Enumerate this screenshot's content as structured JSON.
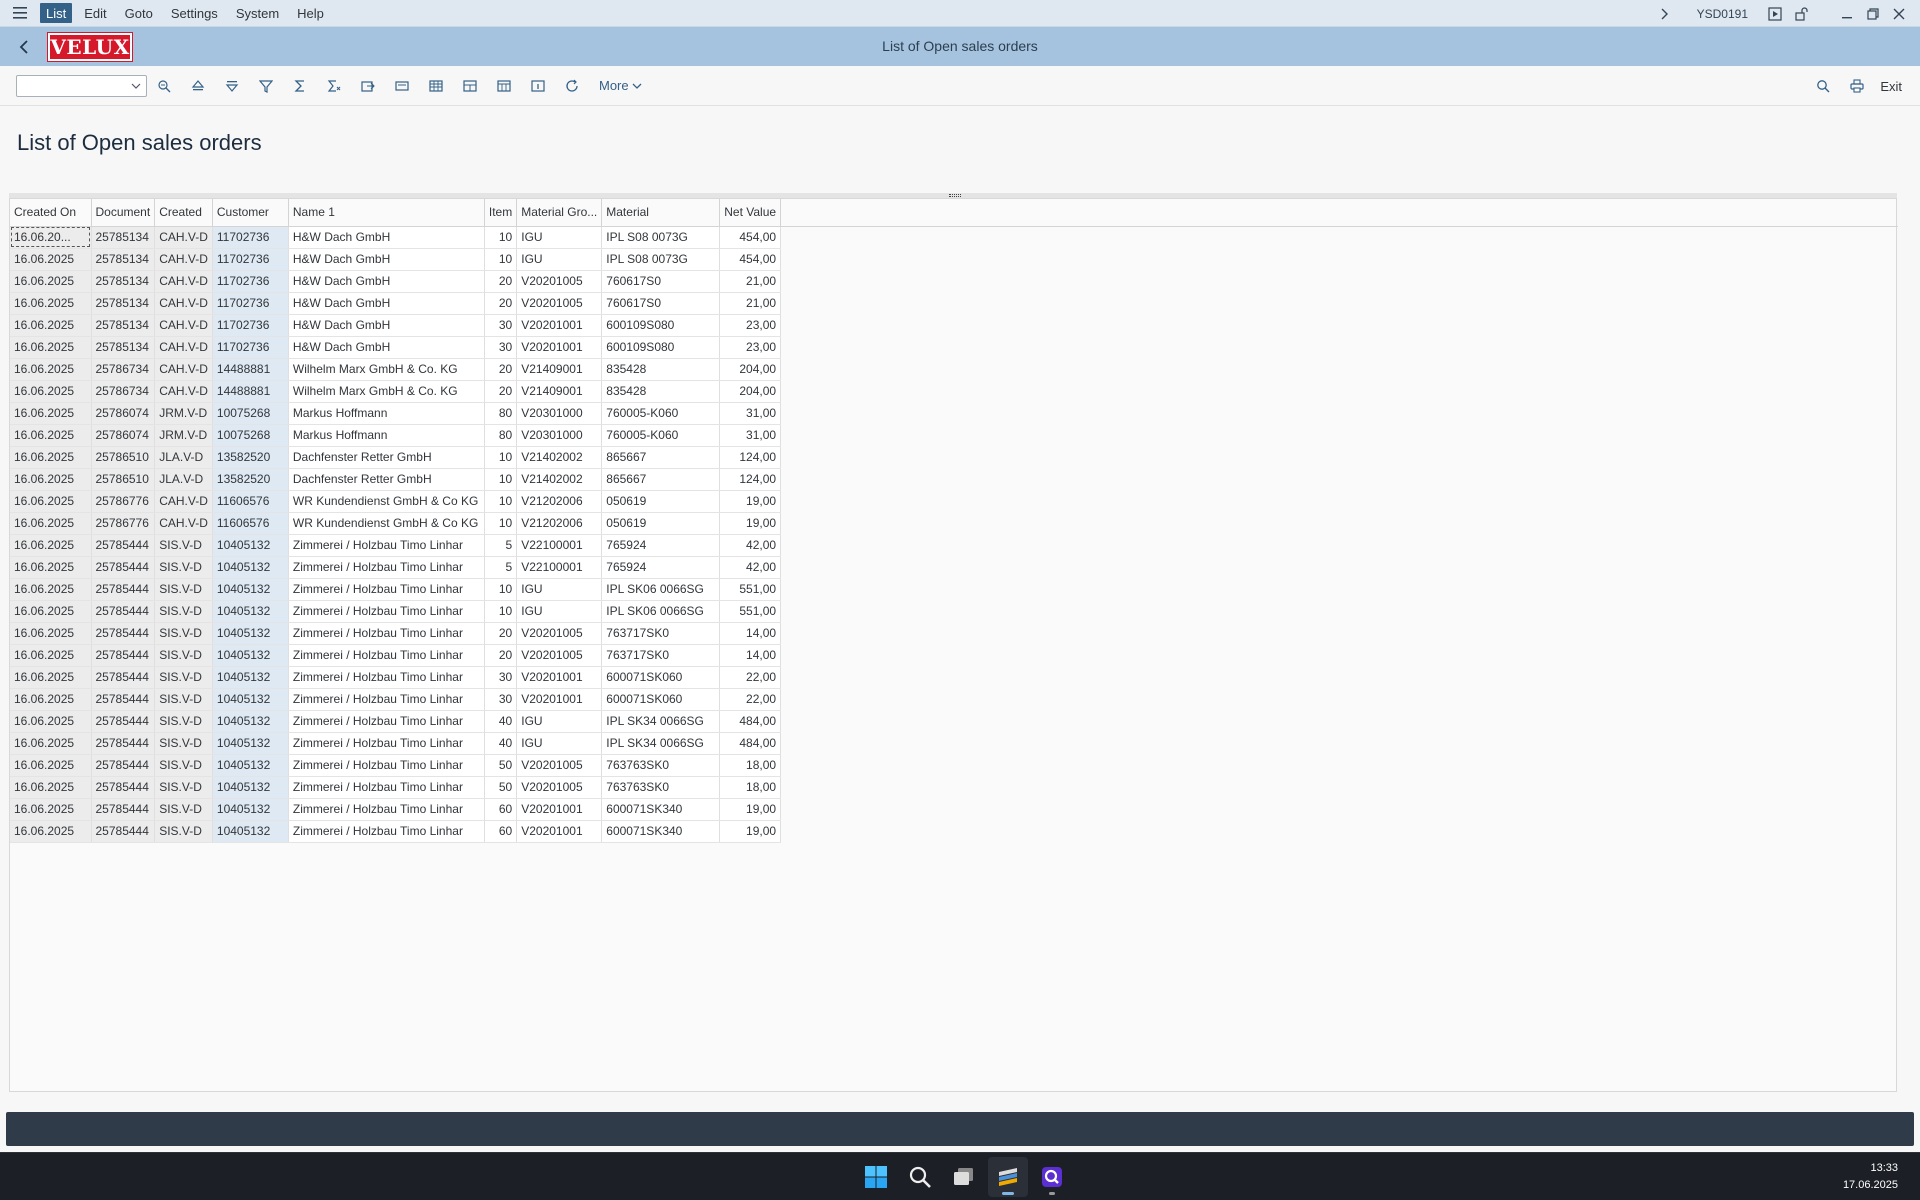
{
  "menubar": {
    "items": [
      "List",
      "Edit",
      "Goto",
      "Settings",
      "System",
      "Help"
    ],
    "system_id": "YSD0191"
  },
  "titlebar": {
    "logo": "VELUX",
    "title": "List of Open sales orders"
  },
  "toolbar": {
    "more_label": "More",
    "exit_label": "Exit"
  },
  "page": {
    "heading": "List of Open sales orders"
  },
  "grid": {
    "columns": [
      "Created On",
      "Document",
      "Created",
      "Customer",
      "Name 1",
      "Item",
      "Material Gro...",
      "Material",
      "Net Value"
    ],
    "rows": [
      [
        "16.06.20...",
        "25785134",
        "CAH.V-D",
        "11702736",
        "H&W Dach GmbH",
        "10",
        "IGU",
        "IPL S08 0073G",
        "454,00"
      ],
      [
        "16.06.2025",
        "25785134",
        "CAH.V-D",
        "11702736",
        "H&W Dach GmbH",
        "10",
        "IGU",
        "IPL S08 0073G",
        "454,00"
      ],
      [
        "16.06.2025",
        "25785134",
        "CAH.V-D",
        "11702736",
        "H&W Dach GmbH",
        "20",
        "V20201005",
        "760617S0",
        "21,00"
      ],
      [
        "16.06.2025",
        "25785134",
        "CAH.V-D",
        "11702736",
        "H&W Dach GmbH",
        "20",
        "V20201005",
        "760617S0",
        "21,00"
      ],
      [
        "16.06.2025",
        "25785134",
        "CAH.V-D",
        "11702736",
        "H&W Dach GmbH",
        "30",
        "V20201001",
        "600109S080",
        "23,00"
      ],
      [
        "16.06.2025",
        "25785134",
        "CAH.V-D",
        "11702736",
        "H&W Dach GmbH",
        "30",
        "V20201001",
        "600109S080",
        "23,00"
      ],
      [
        "16.06.2025",
        "25786734",
        "CAH.V-D",
        "14488881",
        "Wilhelm Marx GmbH & Co. KG",
        "20",
        "V21409001",
        "835428",
        "204,00"
      ],
      [
        "16.06.2025",
        "25786734",
        "CAH.V-D",
        "14488881",
        "Wilhelm Marx GmbH & Co. KG",
        "20",
        "V21409001",
        "835428",
        "204,00"
      ],
      [
        "16.06.2025",
        "25786074",
        "JRM.V-D",
        "10075268",
        "Markus Hoffmann",
        "80",
        "V20301000",
        "760005-K060",
        "31,00"
      ],
      [
        "16.06.2025",
        "25786074",
        "JRM.V-D",
        "10075268",
        "Markus Hoffmann",
        "80",
        "V20301000",
        "760005-K060",
        "31,00"
      ],
      [
        "16.06.2025",
        "25786510",
        "JLA.V-D",
        "13582520",
        "Dachfenster Retter GmbH",
        "10",
        "V21402002",
        "865667",
        "124,00"
      ],
      [
        "16.06.2025",
        "25786510",
        "JLA.V-D",
        "13582520",
        "Dachfenster Retter GmbH",
        "10",
        "V21402002",
        "865667",
        "124,00"
      ],
      [
        "16.06.2025",
        "25786776",
        "CAH.V-D",
        "11606576",
        "WR Kundendienst GmbH & Co KG",
        "10",
        "V21202006",
        "050619",
        "19,00"
      ],
      [
        "16.06.2025",
        "25786776",
        "CAH.V-D",
        "11606576",
        "WR Kundendienst GmbH & Co KG",
        "10",
        "V21202006",
        "050619",
        "19,00"
      ],
      [
        "16.06.2025",
        "25785444",
        "SIS.V-D",
        "10405132",
        "Zimmerei / Holzbau Timo Linhar",
        "5",
        "V22100001",
        "765924",
        "42,00"
      ],
      [
        "16.06.2025",
        "25785444",
        "SIS.V-D",
        "10405132",
        "Zimmerei / Holzbau Timo Linhar",
        "5",
        "V22100001",
        "765924",
        "42,00"
      ],
      [
        "16.06.2025",
        "25785444",
        "SIS.V-D",
        "10405132",
        "Zimmerei / Holzbau Timo Linhar",
        "10",
        "IGU",
        "IPL SK06 0066SG",
        "551,00"
      ],
      [
        "16.06.2025",
        "25785444",
        "SIS.V-D",
        "10405132",
        "Zimmerei / Holzbau Timo Linhar",
        "10",
        "IGU",
        "IPL SK06 0066SG",
        "551,00"
      ],
      [
        "16.06.2025",
        "25785444",
        "SIS.V-D",
        "10405132",
        "Zimmerei / Holzbau Timo Linhar",
        "20",
        "V20201005",
        "763717SK0",
        "14,00"
      ],
      [
        "16.06.2025",
        "25785444",
        "SIS.V-D",
        "10405132",
        "Zimmerei / Holzbau Timo Linhar",
        "20",
        "V20201005",
        "763717SK0",
        "14,00"
      ],
      [
        "16.06.2025",
        "25785444",
        "SIS.V-D",
        "10405132",
        "Zimmerei / Holzbau Timo Linhar",
        "30",
        "V20201001",
        "600071SK060",
        "22,00"
      ],
      [
        "16.06.2025",
        "25785444",
        "SIS.V-D",
        "10405132",
        "Zimmerei / Holzbau Timo Linhar",
        "30",
        "V20201001",
        "600071SK060",
        "22,00"
      ],
      [
        "16.06.2025",
        "25785444",
        "SIS.V-D",
        "10405132",
        "Zimmerei / Holzbau Timo Linhar",
        "40",
        "IGU",
        "IPL SK34 0066SG",
        "484,00"
      ],
      [
        "16.06.2025",
        "25785444",
        "SIS.V-D",
        "10405132",
        "Zimmerei / Holzbau Timo Linhar",
        "40",
        "IGU",
        "IPL SK34 0066SG",
        "484,00"
      ],
      [
        "16.06.2025",
        "25785444",
        "SIS.V-D",
        "10405132",
        "Zimmerei / Holzbau Timo Linhar",
        "50",
        "V20201005",
        "763763SK0",
        "18,00"
      ],
      [
        "16.06.2025",
        "25785444",
        "SIS.V-D",
        "10405132",
        "Zimmerei / Holzbau Timo Linhar",
        "50",
        "V20201005",
        "763763SK0",
        "18,00"
      ],
      [
        "16.06.2025",
        "25785444",
        "SIS.V-D",
        "10405132",
        "Zimmerei / Holzbau Timo Linhar",
        "60",
        "V20201001",
        "600071SK340",
        "19,00"
      ],
      [
        "16.06.2025",
        "25785444",
        "SIS.V-D",
        "10405132",
        "Zimmerei / Holzbau Timo Linhar",
        "60",
        "V20201001",
        "600071SK340",
        "19,00"
      ]
    ]
  },
  "taskbar": {
    "time": "13:33",
    "date": "17.06.2025"
  },
  "colors": {
    "titlebar": "#a5c3de",
    "menubar": "#dfe8f1",
    "menu_active": "#346187",
    "logo_red": "#d6182b",
    "customer_column": "#dfe9f4",
    "statusbar": "#2f3b48",
    "taskbar": "#1c1f26"
  }
}
